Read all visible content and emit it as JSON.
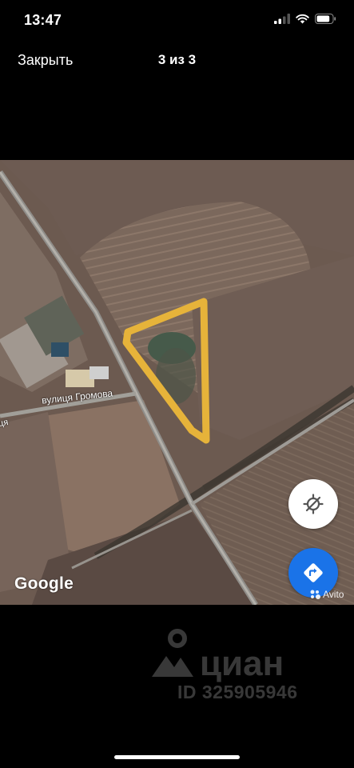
{
  "status_bar": {
    "time": "13:47",
    "battery_level": 0.85
  },
  "nav": {
    "close_label": "Закрыть",
    "counter": "3 из 3"
  },
  "map": {
    "street_label": "вулиця Громова",
    "street_label_2": "вулиця Громова",
    "provider": "Google",
    "highlight_color": "#e6b33a"
  },
  "buttons": {
    "recenter_icon": "recenter-icon",
    "directions_icon": "directions-icon"
  },
  "watermarks": {
    "avito": "Avito",
    "cian_word": "циан",
    "cian_id": "ID 325905946"
  }
}
